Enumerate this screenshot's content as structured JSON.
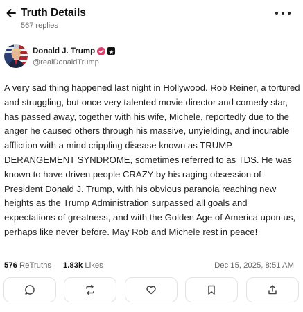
{
  "header": {
    "title": "Truth Details",
    "replies": "567 replies"
  },
  "author": {
    "name": "Donald J. Trump",
    "handle": "@realDonaldTrump"
  },
  "post": {
    "text": "A very sad thing happened last night in Hollywood. Rob Reiner, a tortured and struggling, but once very talented movie director and comedy star, has passed away, together with his wife, Michele, reportedly due to the anger he caused others through his massive, unyielding, and incurable affliction with a mind crippling disease known as TRUMP DERANGEMENT SYNDROME, sometimes referred to as TDS. He was known to have driven people CRAZY by his raging obsession of President Donald J. Trump, with his obvious paranoia reaching new heights as the Trump Administration surpassed all goals and expectations of greatness, and with the Golden Age of America upon us, perhaps like never before. May Rob and Michele rest in peace!"
  },
  "stats": {
    "retruths_count": "576",
    "retruths_label": "ReTruths",
    "likes_count": "1.83k",
    "likes_label": "Likes",
    "timestamp": "Dec 15, 2025, 8:51 AM"
  },
  "actions": [
    {
      "icon": "reply-icon"
    },
    {
      "icon": "retruth-icon"
    },
    {
      "icon": "like-icon"
    },
    {
      "icon": "bookmark-icon"
    },
    {
      "icon": "share-icon"
    }
  ],
  "colors": {
    "verified_badge": "#d93f6a",
    "muted_text": "#6b6b6b",
    "button_border": "#e3e3e3"
  }
}
